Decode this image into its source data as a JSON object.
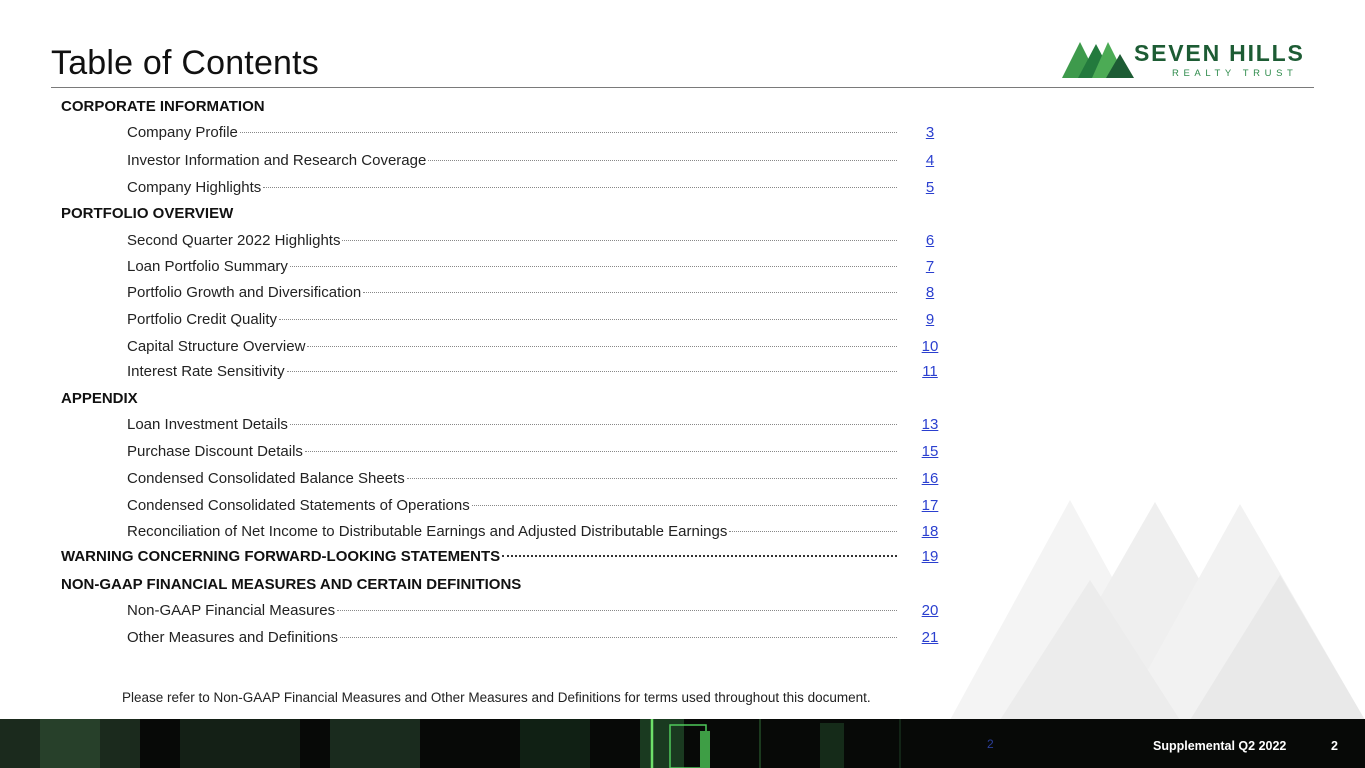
{
  "header": {
    "title": "Table of Contents",
    "logo_main": "SEVEN HILLS",
    "logo_sub": "REALTY TRUST"
  },
  "toc": {
    "sections": [
      {
        "title": "CORPORATE INFORMATION"
      },
      {
        "title": "PORTFOLIO OVERVIEW"
      },
      {
        "title": "APPENDIX"
      },
      {
        "title": "NON-GAAP FINANCIAL MEASURES AND CERTAIN DEFINITIONS"
      }
    ],
    "items": [
      {
        "label": "Company Profile",
        "page": "3"
      },
      {
        "label": "Investor Information and Research Coverage",
        "page": "4"
      },
      {
        "label": "Company Highlights",
        "page": "5"
      },
      {
        "label": "Second Quarter 2022 Highlights",
        "page": "6"
      },
      {
        "label": "Loan Portfolio Summary",
        "page": "7"
      },
      {
        "label": "Portfolio Growth and Diversification",
        "page": "8"
      },
      {
        "label": "Portfolio Credit Quality",
        "page": "9"
      },
      {
        "label": "Capital Structure Overview",
        "page": "10"
      },
      {
        "label": "Interest Rate Sensitivity",
        "page": "11"
      },
      {
        "label": "Loan Investment Details",
        "page": "13"
      },
      {
        "label": "Purchase Discount Details",
        "page": "15"
      },
      {
        "label": "Condensed Consolidated Balance Sheets",
        "page": "16"
      },
      {
        "label": "Condensed Consolidated Statements of Operations",
        "page": "17"
      },
      {
        "label": "Reconciliation of Net Income to Distributable Earnings and Adjusted Distributable Earnings",
        "page": "18"
      },
      {
        "label": "WARNING CONCERNING FORWARD-LOOKING STATEMENTS",
        "page": "19"
      },
      {
        "label": "Non-GAAP Financial Measures",
        "page": "20"
      },
      {
        "label": "Other Measures and Definitions",
        "page": "21"
      }
    ]
  },
  "note": "Please refer to Non-GAAP Financial Measures and Other Measures and Definitions for terms used throughout this document.",
  "footer": {
    "ghost_number": "2",
    "label": "Supplemental Q2 2022",
    "page_number": "2"
  },
  "colors": {
    "brand_green_dark": "#1d5c34",
    "brand_green": "#2e8b4b",
    "link_blue": "#2a3fcf"
  }
}
